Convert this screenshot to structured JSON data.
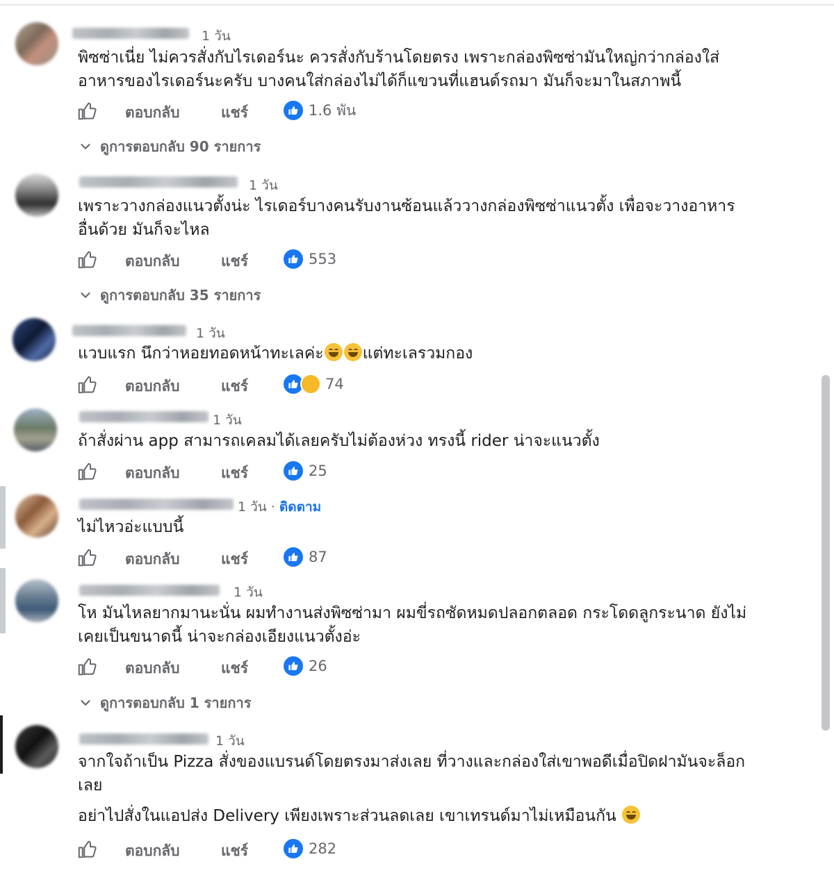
{
  "labels": {
    "reply": "ตอบกลับ",
    "share": "แชร์"
  },
  "colors": {
    "link": "#1b74e4",
    "like": "#1877f2",
    "muted": "#65676b"
  },
  "comments": [
    {
      "time": "1 วัน",
      "lines": [
        "พิซซ่าเนี่ย ไม่ควรสั่งกับไรเดอร์นะ ควรสั่งกับร้านโดยตรง เพราะกล่องพิซซ่ามันใหญ่กว่ากล่องใส่",
        "อาหารของไรเดอร์นะครับ บางคนใส่กล่องไม่ได้ก็แขวนที่แฮนด์รถมา มันก็จะมาในสภาพนี้"
      ],
      "reactions": "1.6 พัน",
      "view_replies": "ดูการตอบกลับ 90 รายการ"
    },
    {
      "time": "1 วัน",
      "lines": [
        "เพราะวางกล่องแนวตั้งน่ะ ไรเดอร์บางคนรับงานซ้อนแล้ววางกล่องพิซซ่าแนวตั้ง เพื่อจะวางอาหาร",
        "อื่นด้วย มันก็จะไหล"
      ],
      "reactions": "553",
      "view_replies": "ดูการตอบกลับ 35 รายการ"
    },
    {
      "time": "1 วัน",
      "text_before": "แวบแรก นึกว่าหอยทอดหน้าทะเลค่ะ",
      "text_after": "แต่ทะเลรวมกอง",
      "reactions": "74"
    },
    {
      "time": "1 วัน",
      "lines": [
        "ถ้าสั่งผ่าน app สามารถเคลมได้เลยครับไม่ต้องห่วง ทรงนี้ rider น่าจะแนวตั้ง"
      ],
      "reactions": "25"
    },
    {
      "time": "1 วัน",
      "follow": "ติดตาม",
      "lines": [
        "ไม่ไหวอ่ะแบบนี้"
      ],
      "reactions": "87"
    },
    {
      "time": "1 วัน",
      "lines": [
        "โห มันไหลยากมานะนั่น ผมทำงานส่งพิซซ่ามา ผมขี่รถซัดหมดปลอกตลอด กระโดดลูกระนาด ยังไม่",
        "เคยเป็นขนาดนี้ น่าจะกล่องเอียงแนวตั้งอ่ะ"
      ],
      "reactions": "26",
      "view_replies": "ดูการตอบกลับ 1 รายการ"
    },
    {
      "time": "1 วัน",
      "lines": [
        "จากใจถ้าเป็น Pizza สั่งของแบรนด์โดยตรงมาส่งเลย ที่วางและกล่องใส่เขาพอดีเมื่อปิดฝามันจะล็อก",
        "เลย"
      ],
      "extra": "อย่าไปสั่งในแอปส่ง Delivery เพียงเพราะส่วนลดเลย เขาเทรนด์มาไม่เหมือนกัน",
      "reactions": "282"
    }
  ]
}
